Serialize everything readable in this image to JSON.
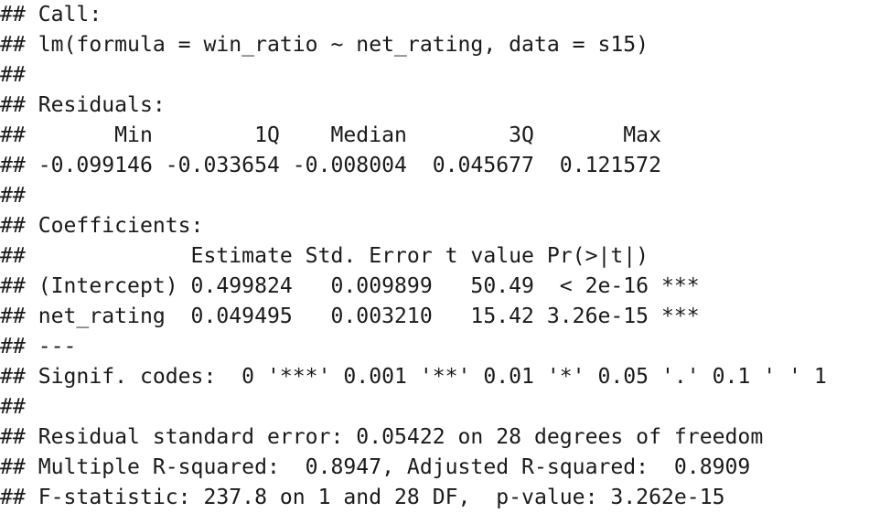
{
  "output": {
    "lines": [
      "## Call:",
      "## lm(formula = win_ratio ~ net_rating, data = s15)",
      "##",
      "## Residuals:",
      "##       Min        1Q    Median        3Q       Max",
      "## -0.099146 -0.033654 -0.008004  0.045677  0.121572",
      "##",
      "## Coefficients:",
      "##             Estimate Std. Error t value Pr(>|t|)",
      "## (Intercept) 0.499824   0.009899   50.49  < 2e-16 ***",
      "## net_rating  0.049495   0.003210   15.42 3.26e-15 ***",
      "## ---",
      "## Signif. codes:  0 '***' 0.001 '**' 0.01 '*' 0.05 '.' 0.1 ' ' 1",
      "##",
      "## Residual standard error: 0.05422 on 28 degrees of freedom",
      "## Multiple R-squared:  0.8947, Adjusted R-squared:  0.8909",
      "## F-statistic: 237.8 on 1 and 28 DF,  p-value: 3.262e-15"
    ]
  }
}
